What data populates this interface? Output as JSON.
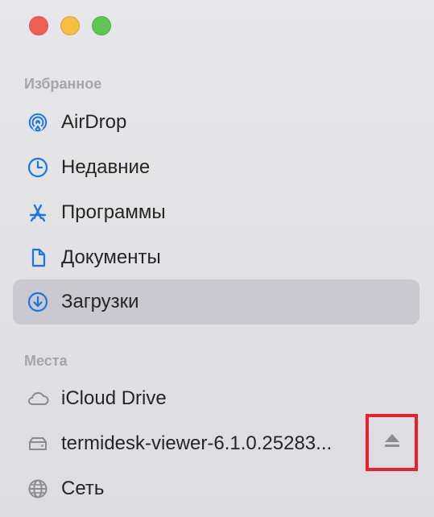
{
  "sidebar": {
    "sections": [
      {
        "title": "Избранное",
        "items": [
          {
            "label": "AirDrop",
            "icon": "airdrop-icon"
          },
          {
            "label": "Недавние",
            "icon": "clock-icon"
          },
          {
            "label": "Программы",
            "icon": "applications-icon"
          },
          {
            "label": "Документы",
            "icon": "document-icon"
          },
          {
            "label": "Загрузки",
            "icon": "download-icon",
            "selected": true
          }
        ]
      },
      {
        "title": "Места",
        "items": [
          {
            "label": "iCloud Drive",
            "icon": "cloud-icon"
          },
          {
            "label": "termidesk-viewer-6.1.0.25283...",
            "icon": "drive-icon",
            "has_eject": true
          },
          {
            "label": "Сеть",
            "icon": "network-icon"
          }
        ]
      }
    ]
  },
  "colors": {
    "accent": "#1a73e8",
    "selected_bg": "#c9c9cf",
    "highlight": "#ea1f29"
  }
}
